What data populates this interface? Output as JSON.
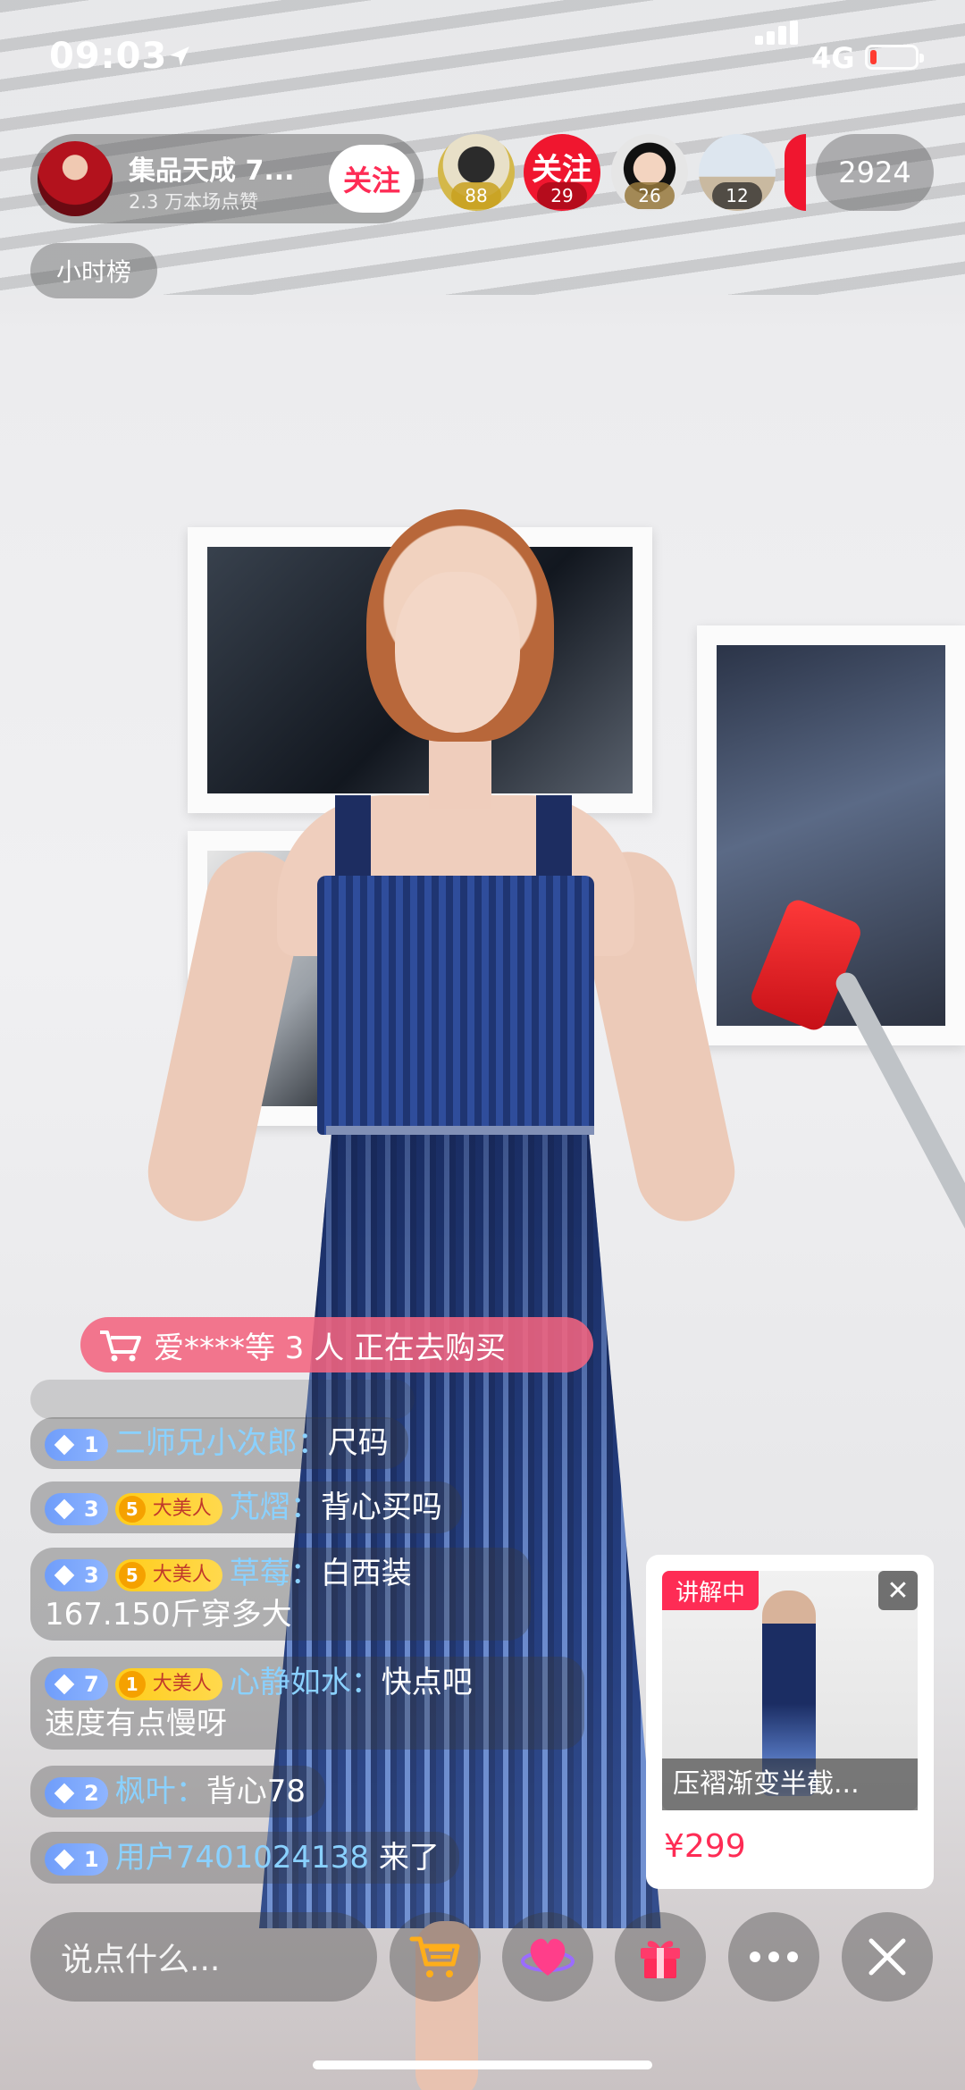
{
  "status_bar": {
    "time": "09:03",
    "network": "4G",
    "battery_level": 0.15
  },
  "host": {
    "name": "集品天成 7...",
    "likes": "2.3 万本场点赞",
    "follow_label": "关注"
  },
  "viewers": [
    {
      "count": "88"
    },
    {
      "count": "29",
      "follow_text": "关注"
    },
    {
      "count": "26"
    },
    {
      "count": "12"
    }
  ],
  "online_count": "2924",
  "hour_rank_label": "小时榜",
  "purchase_banner": {
    "text": "爱****等 3 人 正在去购买"
  },
  "comments": [
    {
      "level": "1",
      "user": "二师兄小次郎：",
      "message": "尺码"
    },
    {
      "level": "3",
      "fan_level": "5",
      "fan_label": "大美人",
      "user": "芃熠：",
      "message": "背心买吗"
    },
    {
      "level": "3",
      "fan_level": "5",
      "fan_label": "大美人",
      "user": "草莓：",
      "message": "白西装",
      "message2": "167.150斤穿多大"
    },
    {
      "level": "7",
      "fan_level": "1",
      "fan_label": "大美人",
      "user": "心静如水：",
      "message": "快点吧",
      "message2": "速度有点慢呀"
    },
    {
      "level": "2",
      "user": "枫叶：",
      "message": "背心78"
    },
    {
      "level": "1",
      "user": "用户7401024138",
      "message": " 来了"
    }
  ],
  "product": {
    "tag": "讲解中",
    "title": "压褶渐变半截...",
    "price": "¥299"
  },
  "bottom_bar": {
    "input_placeholder": "说点什么..."
  },
  "colors": {
    "accent": "#fe2c55",
    "username": "#8ad1ff",
    "level_badge": "#7aa6ff",
    "fan_badge": "#ffd21f",
    "purchase_banner": "#f26480"
  },
  "icons": [
    "location-icon",
    "signal-icon",
    "battery-icon",
    "cart-icon",
    "shopping-cart-icon",
    "heart-icon",
    "gift-icon",
    "more-icon",
    "close-icon"
  ]
}
